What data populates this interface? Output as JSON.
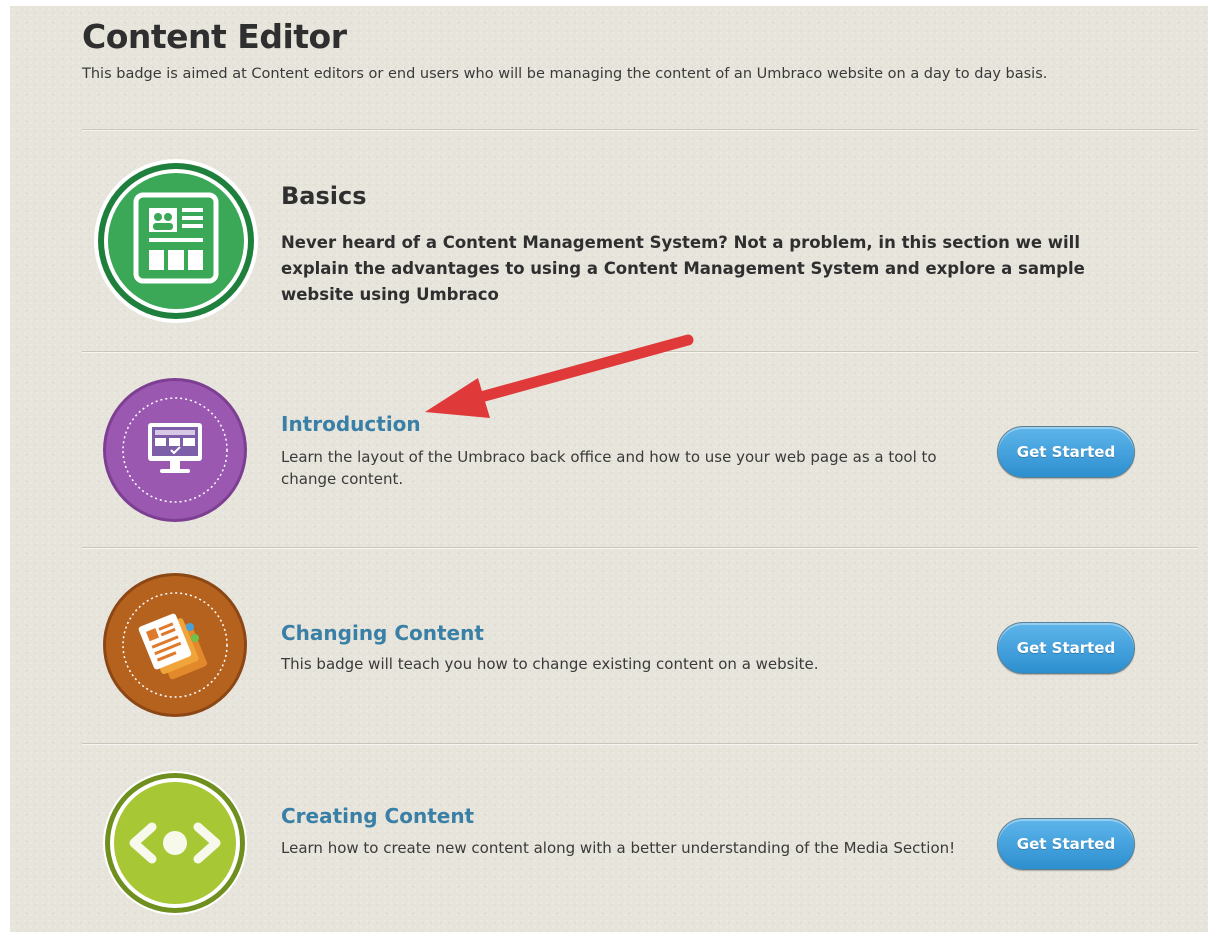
{
  "header": {
    "title": "Content Editor",
    "description": "This badge is aimed at Content editors or end users who will be managing the content of an Umbraco website on a day to day basis."
  },
  "basics": {
    "title": "Basics",
    "text": "Never heard of a Content Management System? Not a problem, in this section we will explain the advantages to using a Content Management System and explore a sample website using Umbraco",
    "icon": "content-page-icon",
    "color": "#3aa857"
  },
  "lessons": [
    {
      "title": "Introduction",
      "description": "Learn the layout of the Umbraco back office and how to use your web page as a tool to change content.",
      "button_label": "Get Started",
      "icon": "monitor-icon",
      "color": "#9a58b0"
    },
    {
      "title": "Changing Content",
      "description": "This badge will teach you how to change existing content on a website.",
      "button_label": "Get Started",
      "icon": "documents-icon",
      "color": "#b5621f"
    },
    {
      "title": "Creating Content",
      "description": "Learn how to create new content along with a better understanding of the Media Section!",
      "button_label": "Get Started",
      "icon": "code-brackets-icon",
      "color": "#a8c734"
    }
  ],
  "annotation": {
    "icon": "red-arrow-icon",
    "color": "#e0393a"
  }
}
